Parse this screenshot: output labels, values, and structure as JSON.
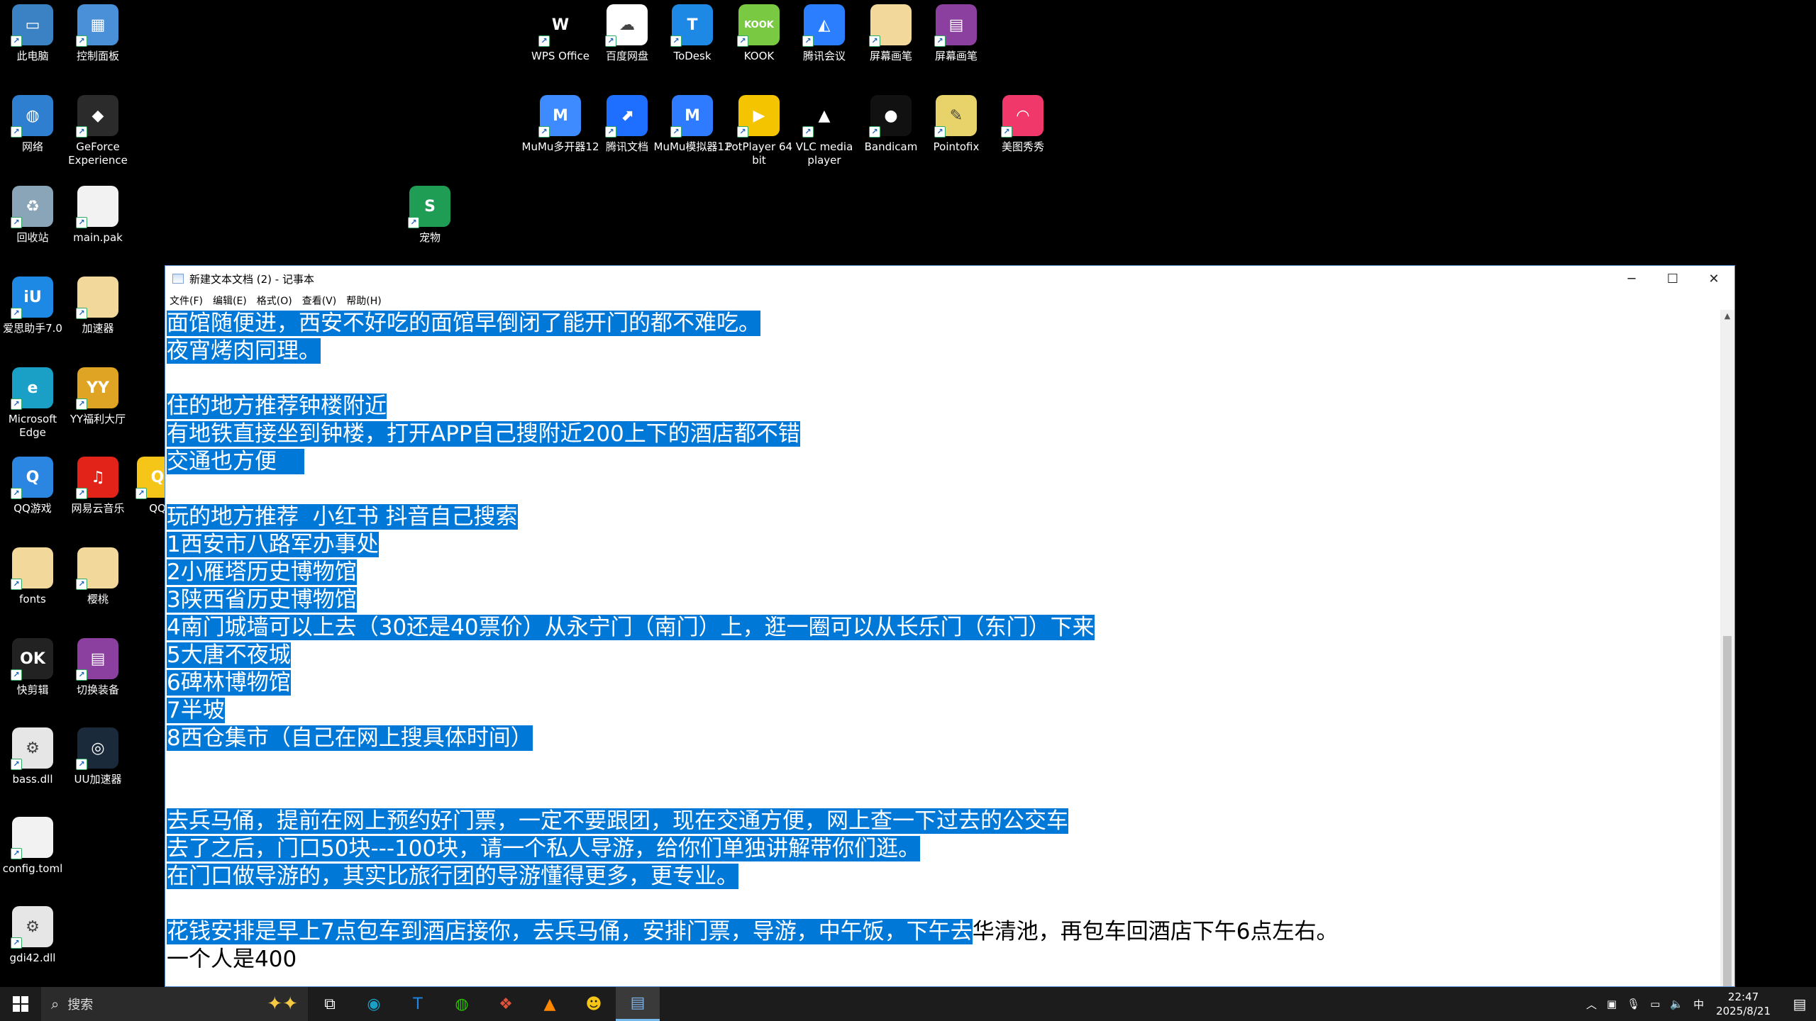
{
  "desktop_icons": [
    {
      "label": "此电脑",
      "icon": "computer-icon",
      "color": "#3b82c4",
      "glyph": "▭"
    },
    {
      "label": "控制面板",
      "icon": "control-panel-icon",
      "color": "#4a90d9",
      "glyph": "▦"
    },
    {
      "label": "网络",
      "icon": "network-icon",
      "color": "#2f7fd1",
      "glyph": "◍"
    },
    {
      "label": "GeForce Experience",
      "icon": "geforce-icon",
      "color": "#2b2b2b",
      "glyph": "◆"
    },
    {
      "label": "回收站",
      "icon": "recycle-bin-icon",
      "color": "#8aa4b8",
      "glyph": "♻"
    },
    {
      "label": "main.pak",
      "icon": "file-icon",
      "color": "#f2f2f2",
      "glyph": ""
    },
    {
      "label": "宠物",
      "icon": "spreadsheet-icon",
      "color": "#1f9d55",
      "glyph": "S"
    },
    {
      "label": "爱思助手7.0",
      "icon": "aisi-icon",
      "color": "#1e88e5",
      "glyph": "iU"
    },
    {
      "label": "加速器",
      "icon": "folder-icon",
      "color": "#f3d89b",
      "glyph": ""
    },
    {
      "label": "Microsoft Edge",
      "icon": "edge-icon",
      "color": "#1aa0c7",
      "glyph": "e"
    },
    {
      "label": "YY福利大厅",
      "icon": "yy-icon",
      "color": "#e0a424",
      "glyph": "YY"
    },
    {
      "label": "QQ游戏",
      "icon": "qq-game-icon",
      "color": "#2a86e0",
      "glyph": "Q"
    },
    {
      "label": "网易云音乐",
      "icon": "netease-music-icon",
      "color": "#e2231a",
      "glyph": "♫"
    },
    {
      "label": "QQ",
      "icon": "qq-icon",
      "color": "#f5c518",
      "glyph": "Q"
    },
    {
      "label": "fonts",
      "icon": "folder-icon",
      "color": "#f3d89b",
      "glyph": ""
    },
    {
      "label": "樱桃",
      "icon": "folder-icon",
      "color": "#f3d89b",
      "glyph": ""
    },
    {
      "label": "快剪辑",
      "icon": "kuaijianji-icon",
      "color": "#222222",
      "glyph": "OK"
    },
    {
      "label": "切换装备",
      "icon": "winrar-icon",
      "color": "#8b3f9e",
      "glyph": "▤"
    },
    {
      "label": "bass.dll",
      "icon": "dll-file-icon",
      "color": "#e6e6e6",
      "glyph": "⚙"
    },
    {
      "label": "UU加速器",
      "icon": "uu-icon",
      "color": "#1a2a3a",
      "glyph": "◎"
    },
    {
      "label": "config.toml",
      "icon": "file-icon",
      "color": "#f2f2f2",
      "glyph": ""
    },
    {
      "label": "gdi42.dll",
      "icon": "dll-file-icon",
      "color": "#e6e6e6",
      "glyph": "⚙"
    },
    {
      "label": "WPS Office",
      "icon": "wps-icon",
      "color": "#000000",
      "glyph": "W"
    },
    {
      "label": "百度网盘",
      "icon": "baidu-netdisk-icon",
      "color": "#ffffff",
      "glyph": "☁"
    },
    {
      "label": "ToDesk",
      "icon": "todesk-icon",
      "color": "#1e88e5",
      "glyph": "T"
    },
    {
      "label": "KOOK",
      "icon": "kook-icon",
      "color": "#7ac943",
      "glyph": "KOOK"
    },
    {
      "label": "腾讯会议",
      "icon": "tencent-meeting-icon",
      "color": "#2b7fff",
      "glyph": "◭"
    },
    {
      "label": "屏幕画笔",
      "icon": "folder-icon",
      "color": "#f3d89b",
      "glyph": ""
    },
    {
      "label": "屏幕画笔",
      "icon": "winrar-icon",
      "color": "#8b3f9e",
      "glyph": "▤"
    },
    {
      "label": "MuMu多开器12",
      "icon": "mumu-multi-icon",
      "color": "#3d8bff",
      "glyph": "M"
    },
    {
      "label": "腾讯文档",
      "icon": "tencent-docs-icon",
      "color": "#1e6fff",
      "glyph": "⬈"
    },
    {
      "label": "MuMu模拟器12",
      "icon": "mumu-emulator-icon",
      "color": "#2f7bff",
      "glyph": "M"
    },
    {
      "label": "PotPlayer 64 bit",
      "icon": "potplayer-icon",
      "color": "#f5c400",
      "glyph": "▶"
    },
    {
      "label": "VLC media player",
      "icon": "vlc-icon",
      "color": "#000000",
      "glyph": "▲"
    },
    {
      "label": "Bandicam",
      "icon": "bandicam-icon",
      "color": "#111111",
      "glyph": "●"
    },
    {
      "label": "Pointofix",
      "icon": "pointofix-icon",
      "color": "#e8d36a",
      "glyph": "✎"
    },
    {
      "label": "美图秀秀",
      "icon": "meitu-icon",
      "color": "#f0386b",
      "glyph": "◠"
    }
  ],
  "notepad": {
    "title": "新建文本文档 (2) - 记事本",
    "menu": [
      "文件(F)",
      "编辑(E)",
      "格式(O)",
      "查看(V)",
      "帮助(H)"
    ],
    "lines": [
      {
        "sel": "面馆随便进，西安不好吃的面馆早倒闭了能开门的都不难吃。",
        "rest": ""
      },
      {
        "sel": "夜宵烤肉同理。",
        "rest": ""
      },
      {
        "sel": "",
        "rest": ""
      },
      {
        "sel": "住的地方推荐钟楼附近",
        "rest": ""
      },
      {
        "sel": "有地铁直接坐到钟楼，打开APP自己搜附近200上下的酒店都不错",
        "rest": ""
      },
      {
        "sel": "交通也方便    ",
        "rest": ""
      },
      {
        "sel": "",
        "rest": ""
      },
      {
        "sel": "玩的地方推荐  小红书 抖音自己搜索",
        "rest": ""
      },
      {
        "sel": "1西安市八路军办事处",
        "rest": ""
      },
      {
        "sel": "2小雁塔历史博物馆",
        "rest": ""
      },
      {
        "sel": "3陕西省历史博物馆",
        "rest": ""
      },
      {
        "sel": "4南门城墙可以上去（30还是40票价）从永宁门（南门）上，逛一圈可以从长乐门（东门）下来",
        "rest": ""
      },
      {
        "sel": "5大唐不夜城",
        "rest": ""
      },
      {
        "sel": "6碑林博物馆",
        "rest": ""
      },
      {
        "sel": "7半坡",
        "rest": ""
      },
      {
        "sel": "8西仓集市（自己在网上搜具体时间）",
        "rest": ""
      },
      {
        "sel": "",
        "rest": ""
      },
      {
        "sel": "",
        "rest": ""
      },
      {
        "sel": "去兵马俑，提前在网上预约好门票，一定不要跟团，现在交通方便，网上查一下过去的公交车",
        "rest": ""
      },
      {
        "sel": "去了之后，门口50块---100块，请一个私人导游，给你们单独讲解带你们逛。",
        "rest": ""
      },
      {
        "sel": "在门口做导游的，其实比旅行团的导游懂得更多，更专业。",
        "rest": ""
      },
      {
        "sel": "",
        "rest": ""
      },
      {
        "sel": "花钱安排是早上7点包车到酒店接你，去兵马俑，安排门票，导游，中午饭，下午去",
        "rest": "华清池，再包车回酒店下午6点左右。"
      },
      {
        "sel": "",
        "rest": "一个人是400"
      }
    ]
  },
  "taskbar": {
    "search_placeholder": "搜索",
    "apps": [
      "task-view-icon",
      "edge-icon",
      "todesk-icon",
      "wechat-icon",
      "app-icon",
      "vlc-icon",
      "yy-icon",
      "notepad-icon"
    ],
    "tray_ime": "中",
    "time": "22:47",
    "date": "2025/8/21"
  }
}
